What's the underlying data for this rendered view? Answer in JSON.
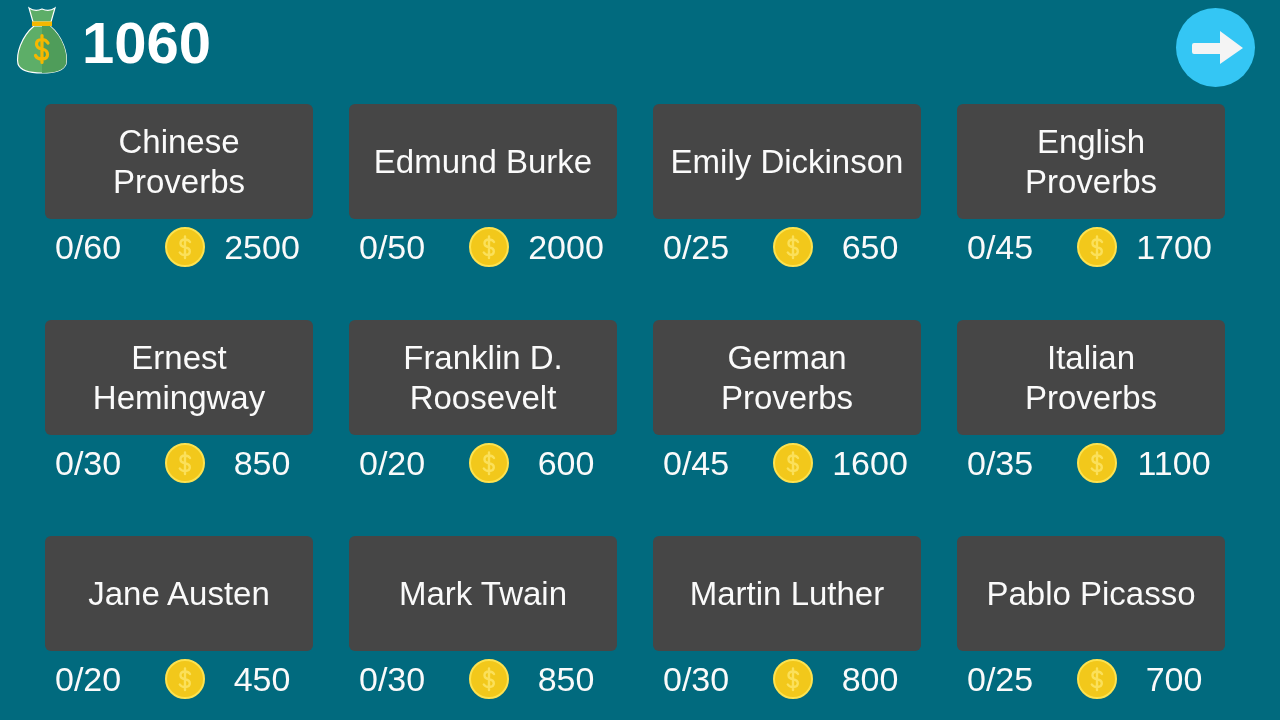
{
  "balance": "1060",
  "categories": [
    {
      "title": "Chinese\nProverbs",
      "progress": "0/60",
      "price": "2500"
    },
    {
      "title": "Edmund Burke",
      "progress": "0/50",
      "price": "2000"
    },
    {
      "title": "Emily Dickinson",
      "progress": "0/25",
      "price": "650"
    },
    {
      "title": "English\nProverbs",
      "progress": "0/45",
      "price": "1700"
    },
    {
      "title": "Ernest\nHemingway",
      "progress": "0/30",
      "price": "850"
    },
    {
      "title": "Franklin D.\nRoosevelt",
      "progress": "0/20",
      "price": "600"
    },
    {
      "title": "German\nProverbs",
      "progress": "0/45",
      "price": "1600"
    },
    {
      "title": "Italian\nProverbs",
      "progress": "0/35",
      "price": "1100"
    },
    {
      "title": "Jane Austen",
      "progress": "0/20",
      "price": "450"
    },
    {
      "title": "Mark Twain",
      "progress": "0/30",
      "price": "850"
    },
    {
      "title": "Martin Luther",
      "progress": "0/30",
      "price": "800"
    },
    {
      "title": "Pablo Picasso",
      "progress": "0/25",
      "price": "700"
    }
  ]
}
